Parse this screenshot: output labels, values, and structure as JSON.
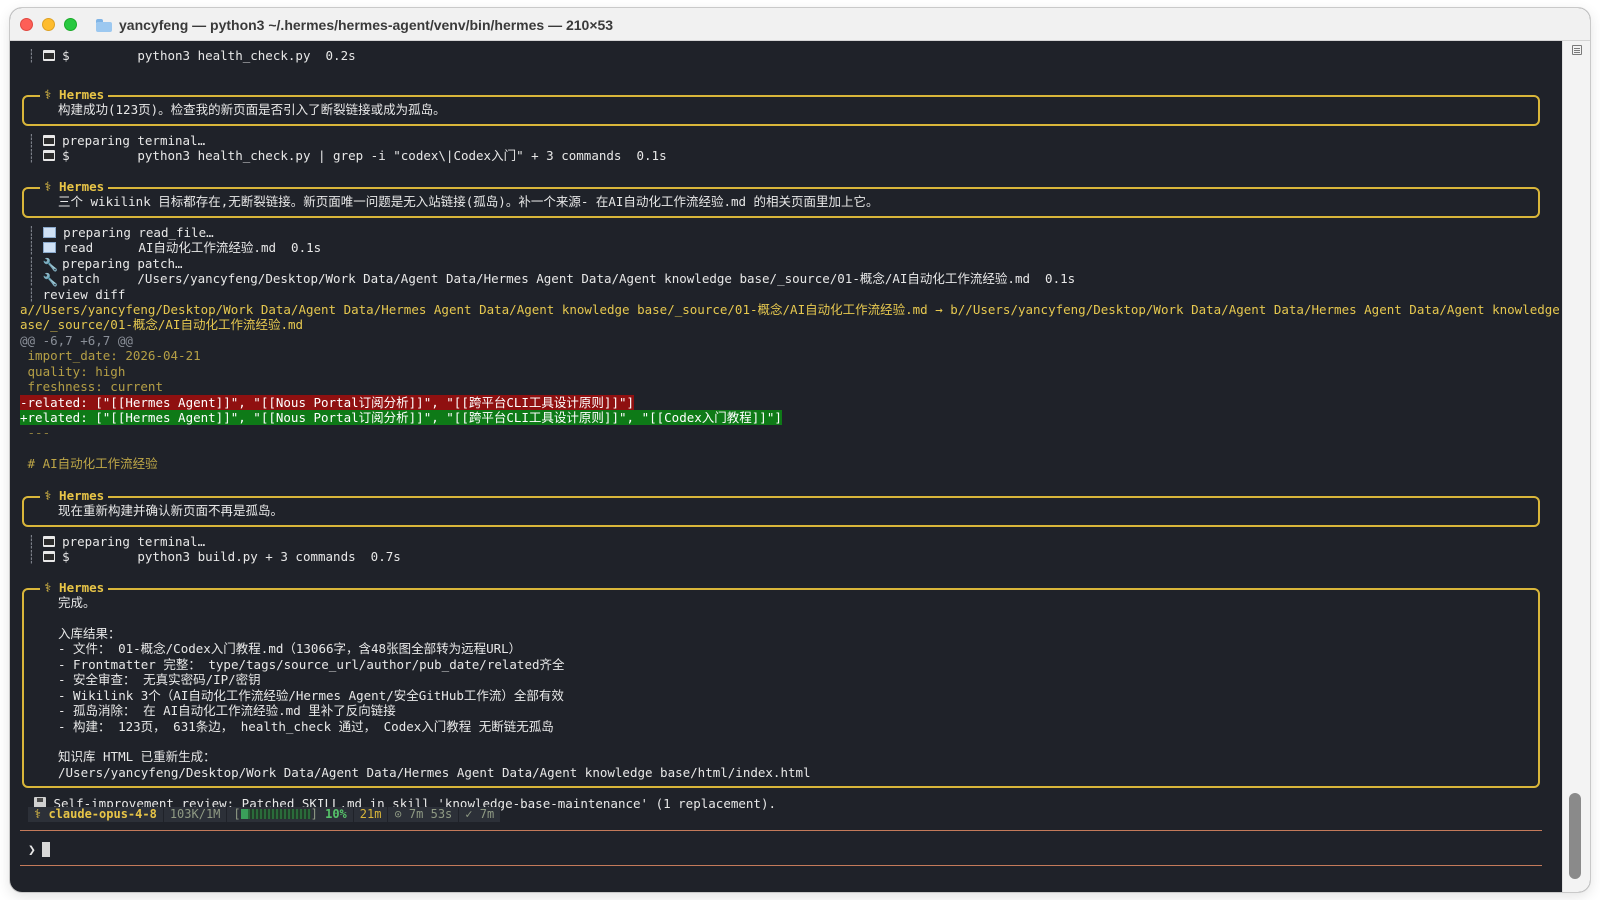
{
  "window": {
    "title": "yancyfeng — python3 ~/.hermes/hermes-agent/venv/bin/hermes — 210×53"
  },
  "terminal": {
    "line01": "python3 health_check.py  0.2s",
    "hermes1_label": "⚕ Hermes",
    "hermes1_text": "构建成功(123页)。检查我的新页面是否引入了断裂链接或成为孤岛。",
    "line02a": "preparing terminal…",
    "line02b": "python3 health_check.py | grep -i \"codex\\|Codex入门\" + 3 commands  0.1s",
    "hermes2_label": "⚕ Hermes",
    "hermes2_text": "三个 wikilink 目标都存在,无断裂链接。新页面唯一问题是无入站链接(孤岛)。补一个来源- 在AI自动化工作流经验.md 的相关页面里加上它。",
    "tool1": "preparing read_file…",
    "tool2_name": "read",
    "tool2_arg": "AI自动化工作流经验.md  0.1s",
    "tool3": "preparing patch…",
    "tool4_name": "patch",
    "tool4_arg": "/Users/yancyfeng/Desktop/Work Data/Agent Data/Hermes Agent Data/Agent knowledge base/_source/01-概念/AI自动化工作流经验.md  0.1s",
    "tool5": "review diff",
    "diff_path1": "a//Users/yancyfeng/Desktop/Work Data/Agent Data/Hermes Agent Data/Agent knowledge base/_source/01-概念/AI自动化工作流经验.md → b//Users/yancyfeng/Desktop/Work Data/Agent Data/Hermes Agent Data/Agent knowledge b",
    "diff_path2": "ase/_source/01-概念/AI自动化工作流经验.md",
    "diff_hunk": "@@ -6,7 +6,7 @@",
    "diff_ctx1": " import_date: 2026-04-21",
    "diff_ctx2": " quality: high",
    "diff_ctx3": " freshness: current",
    "diff_del": "-related: [\"[[Hermes Agent]]\", \"[[Nous Portal订阅分析]]\", \"[[跨平台CLI工具设计原则]]\"]",
    "diff_add": "+related: [\"[[Hermes Agent]]\", \"[[Nous Portal订阅分析]]\", \"[[跨平台CLI工具设计原则]]\", \"[[Codex入门教程]]\"]",
    "diff_ctx4": " ---",
    "diff_ctx5": " # AI自动化工作流经验",
    "hermes3_label": "⚕ Hermes",
    "hermes3_text": "现在重新构建并确认新页面不再是孤岛。",
    "line03a": "preparing terminal…",
    "line03b": "python3 build.py + 3 commands  0.7s",
    "hermes4_label": "⚕ Hermes",
    "hermes4_lines": [
      "完成。",
      "",
      "入库结果：",
      "- 文件： 01-概念/Codex入门教程.md（13066字，含48张图全部转为远程URL）",
      "- Frontmatter 完整： type/tags/source_url/author/pub_date/related齐全",
      "- 安全审查： 无真实密码/IP/密钥",
      "- Wikilink 3个（AI自动化工作流经验/Hermes Agent/安全GitHub工作流）全部有效",
      "- 孤岛消除： 在 AI自动化工作流经验.md 里补了反向链接",
      "- 构建： 123页， 631条边， health_check 通过， Codex入门教程 无断链无孤岛",
      "",
      "知识库 HTML 已重新生成：",
      "/Users/yancyfeng/Desktop/Work Data/Agent Data/Hermes Agent Data/Agent knowledge base/html/index.html"
    ],
    "self_review": "Self-improvement review: Patched SKILL.md in skill 'knowledge-base-maintenance' (1 replacement)."
  },
  "statusbar": {
    "model": "⚕ claude-opus-4-8",
    "tokens": "103K/1M",
    "context_percent": "10%",
    "context_fraction": 0.1,
    "elapsed": "21m",
    "timer": "⊙ 7m 53s",
    "check": "✓ 7m"
  },
  "prompt": {
    "symbol": "❯"
  },
  "colors": {
    "accent": "#e8c547",
    "diff_del_bg": "#8f1010",
    "diff_add_bg": "#0e7a17",
    "background": "#1f2229"
  }
}
